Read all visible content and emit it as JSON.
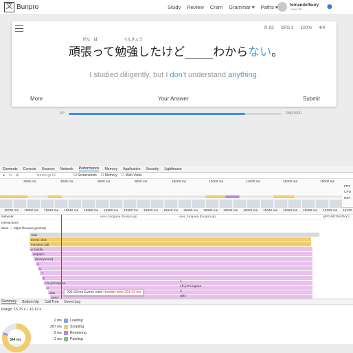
{
  "nav": {
    "logo_glyph": "文",
    "logo_text": "Bunpro",
    "links": [
      "Study",
      "Review",
      "Cram",
      "Grammar ▾",
      "Paths ▾"
    ],
    "username": "fernandofleury",
    "level": "Level 33"
  },
  "card": {
    "stats": [
      "R 82",
      "SRS 3",
      "100%",
      "4/4"
    ],
    "jp_before": "頑張って勉強したけど",
    "jp_after": "わから",
    "jp_blue": "ない",
    "jp_end": "。",
    "furigana": [
      "がん　ば",
      "べんきょう"
    ],
    "en_parts": [
      "I studied diligently, but I ",
      "don't",
      " understand ",
      "anything",
      "."
    ],
    "footer": {
      "more": "More",
      "answer_placeholder": "Your Answer",
      "submit": "Submit"
    }
  },
  "progress": {
    "current_label": "33°",
    "value": 0.83,
    "total": "1350/1600"
  },
  "devtools": {
    "tabs": [
      "Elements",
      "Console",
      "Sources",
      "Network",
      "Performance",
      "Memory",
      "Application",
      "Security",
      "Lighthouse"
    ],
    "active_tab": "Performance",
    "toolbar": [
      "bunpro.jp #1",
      "Screenshots",
      "Memory",
      "Web Vitals"
    ],
    "overview_ticks": [
      "2000 ms",
      "4000 ms",
      "6000 ms",
      "8000 ms",
      "10000 ms",
      "12000 ms",
      "14000 ms",
      "16000 ms",
      "18000 ms"
    ],
    "side_labels": [
      "FPS",
      "CPU",
      "NET"
    ],
    "ruler_ticks": [
      "15780 ms",
      "15800 ms",
      "15820 ms",
      "15840 ms",
      "15860 ms",
      "15880 ms",
      "15900 ms",
      "15920 ms",
      "15940 ms",
      "15960 ms",
      "15980 ms",
      "16000 ms",
      "16020 ms",
      "16040 ms",
      "16060 ms",
      "16080 ms",
      "16100 ms",
      "16120 ms"
    ],
    "network_items": [
      "user_furigana (bunpro.jp)",
      "user_furigana (bunpro.jp)",
      "gtP0-NE3N83NYJ..."
    ],
    "sections": [
      "Network",
      "Interactions",
      "Main — https://bunpro.jp/study"
    ],
    "flame": [
      {
        "name": "Task",
        "color": "#d9d9d9"
      },
      {
        "name": "Event: click",
        "color": "#f2cc6b"
      },
      {
        "name": "Function Call",
        "color": "#f2cc6b"
      },
      {
        "name": "g.handle",
        "color": "#e8c1ec"
      },
      {
        "name": "dispatch",
        "color": "#e8c1ec"
      },
      {
        "name": "(anonymous)",
        "color": "#e8c1ec"
      },
      {
        "name": "q",
        "color": "#e8c1ec"
      },
      {
        "name": "O",
        "color": "#e8c1ec"
      },
      {
        "name": "T",
        "color": "#e8c1ec"
      },
      {
        "name": "k",
        "color": "#e8c1ec"
      },
      {
        "name": "t.fn.jVFurigana",
        "color": "#e8c1ec"
      },
      {
        "name": "n",
        "color": "#e8c1ec"
      },
      {
        "name": "ajax",
        "color": "#e8c1ec"
      },
      {
        "name": "send",
        "color": "#e8c1ec"
      }
    ],
    "right_labels": [
      "v",
      "t.fn.jVFurigana",
      "n",
      "ajax"
    ],
    "tooltip": {
      "time": "291.63 ms",
      "event": "Event: click",
      "warning": "Handler took 291.63 ms"
    },
    "summary_tabs": [
      "Summary",
      "Bottom-Up",
      "Call Tree",
      "Event Log"
    ],
    "range": "Range: 15.76 s – 16.12 s",
    "legend": [
      {
        "value": "2 ms",
        "label": "Loading",
        "color": "#7aa7e0"
      },
      {
        "value": "287 ms",
        "label": "Scripting",
        "color": "#f2cc6b"
      },
      {
        "value": "9 ms",
        "label": "Rendering",
        "color": "#b48ae0"
      },
      {
        "value": "1 ms",
        "label": "Painting",
        "color": "#7bc47b"
      }
    ],
    "total": "364 ms"
  }
}
